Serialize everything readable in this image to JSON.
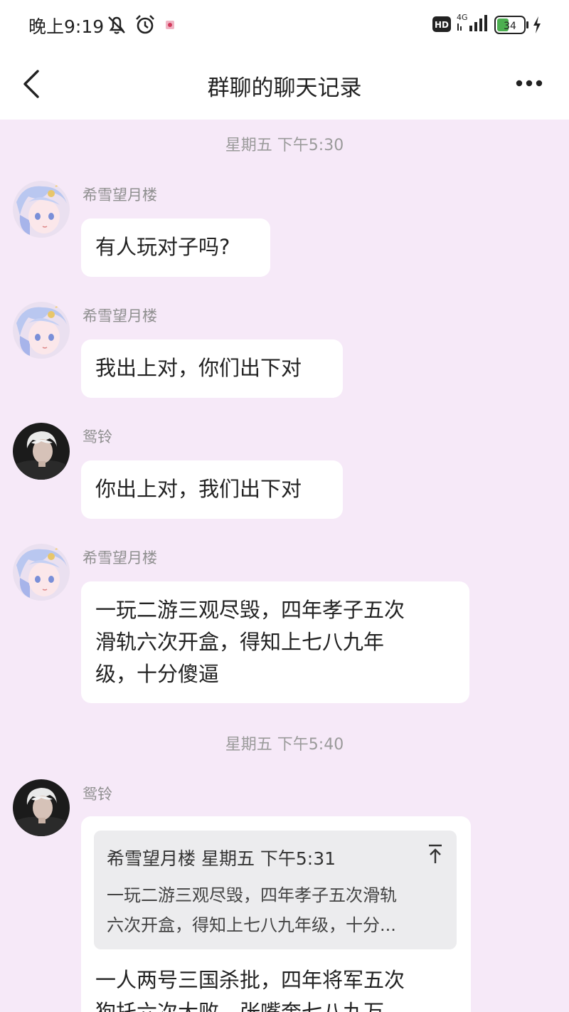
{
  "status_bar": {
    "time": "晚上9:19",
    "battery": "34",
    "network": "4G",
    "hd": "HD",
    "icons": [
      "mute-icon",
      "alarm-icon",
      "notification-icon",
      "hd-icon",
      "signal-icon",
      "battery-icon",
      "charging-icon"
    ]
  },
  "header": {
    "title": "群聊的聊天记录",
    "back_icon": "chevron-left-icon",
    "more_icon": "more-dots-icon"
  },
  "messages": [
    {
      "type": "time",
      "text": "星期五 下午5:30"
    },
    {
      "sender": "希雪望月楼",
      "avatar": "anime-avatar",
      "text": "有人玩对子吗?"
    },
    {
      "sender": "希雪望月楼",
      "avatar": "anime-avatar",
      "text": "我出上对，你们出下对"
    },
    {
      "sender": "鸳铃",
      "avatar": "photo-avatar",
      "text": "你出上对，我们出下对"
    },
    {
      "sender": "希雪望月楼",
      "avatar": "anime-avatar",
      "lines": [
        "一玩二游三观尽毁，四年孝子五次",
        "滑轨六次开盒，得知上七八九年",
        "级，十分傻逼"
      ]
    },
    {
      "type": "time",
      "text": "星期五 下午5:40"
    },
    {
      "sender": "鸳铃",
      "avatar": "photo-avatar",
      "quote": {
        "header": "希雪望月楼 星期五 下午5:31",
        "lines": [
          "一玩二游三观尽毁，四年孝子五次滑轨",
          "六次开盒，得知上七八九年级，十分..."
        ],
        "icon": "arrow-up-icon"
      },
      "lines": [
        "一人两号三国杀批，四年将军五次",
        "狗托六次大败，张嘴奔七八九万"
      ]
    }
  ],
  "colors": {
    "background": "#f6e9f8",
    "bubble": "#ffffff",
    "quote_bg": "#ececee",
    "battery_green": "#4caf50"
  }
}
